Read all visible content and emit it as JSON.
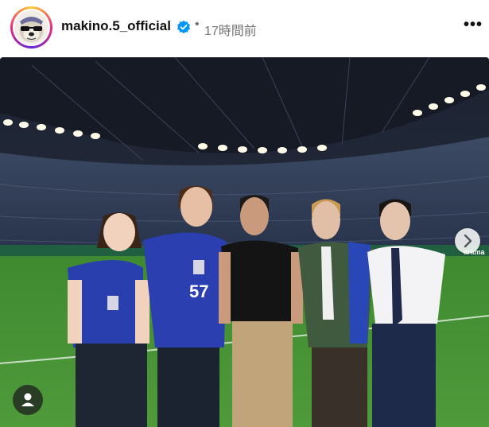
{
  "post": {
    "username": "makino.5_official",
    "separator": "•",
    "time_ago": "17時間前",
    "more_label": "•••"
  },
  "photo": {
    "jersey_number": "57",
    "board_text": "arama"
  },
  "icons": {
    "avatar": "bulldog-avatar",
    "verified": "verified-badge-icon",
    "more": "more-options-icon",
    "next": "chevron-right-icon",
    "tag": "user-tag-icon"
  },
  "colors": {
    "verified_blue": "#0095f6",
    "meta_gray": "#737373",
    "pitch_green": "#4f9a3a"
  }
}
